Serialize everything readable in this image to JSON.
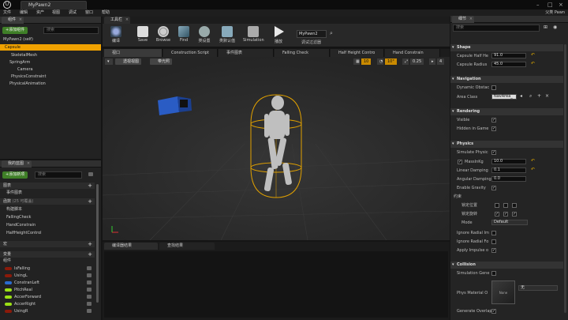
{
  "window": {
    "title": "MyPawn2",
    "user": "父类 Pawn",
    "controls": [
      "–",
      "□",
      "×"
    ]
  },
  "menubar": {
    "items": [
      "文件",
      "编辑",
      "资产",
      "视图",
      "调试",
      "窗口",
      "帮助"
    ]
  },
  "components_panel": {
    "tab": "组件",
    "add_button": "+添加组件",
    "search_placeholder": "搜索",
    "items": [
      {
        "label": "MyPawn2 (self)",
        "level": 0
      },
      {
        "label": "Capsule",
        "level": 0,
        "selected": true
      },
      {
        "label": "SkeletalMesh",
        "level": 1
      },
      {
        "label": "SpringArm",
        "level": 1
      },
      {
        "label": "Camera",
        "level": 2
      },
      {
        "label": "PhysicsConstraint",
        "level": 1
      },
      {
        "label": "PhysicalAnimation",
        "level": 1
      }
    ]
  },
  "mybp_panel": {
    "tab": "我的蓝图",
    "add_button": "+添加新项",
    "search_placeholder": "搜索",
    "sections": {
      "graphs": "图表",
      "event_graph": "事件图表",
      "functions": "函数",
      "functions_count": "(25 可覆盖)",
      "macros": "宏",
      "variables": "变量",
      "components": "组件"
    },
    "functions": [
      "构建脚本",
      "FallingCheck",
      "HandConstrain",
      "HalfHeightControl"
    ],
    "variables": [
      {
        "name": "IsFalling",
        "color": "#8b1a0a"
      },
      {
        "name": "UsingL",
        "color": "#8b1a0a"
      },
      {
        "name": "ConstranLeft",
        "color": "#2a6bd1"
      },
      {
        "name": "PitchReal",
        "color": "#9be015"
      },
      {
        "name": "AccerForward",
        "color": "#9be015"
      },
      {
        "name": "AccerRight",
        "color": "#9be015"
      },
      {
        "name": "UsingR",
        "color": "#8b1a0a"
      }
    ]
  },
  "toolbar": {
    "doc_tab": "工具栏",
    "buttons": [
      {
        "label": "编译",
        "icon": "compile-icon"
      },
      {
        "label": "Save",
        "icon": "save-icon"
      },
      {
        "label": "Browse",
        "icon": "browse-icon"
      },
      {
        "label": "Find",
        "icon": "find-icon"
      },
      {
        "label": "类设置",
        "icon": "class-settings-icon"
      },
      {
        "label": "类默认值",
        "icon": "class-defaults-icon"
      },
      {
        "label": "Simulation",
        "icon": "simulation-icon"
      },
      {
        "label": "播放",
        "icon": "play-icon"
      }
    ],
    "debug_object": "MyPawn2",
    "debug_label": "调试过滤器"
  },
  "editor_tabs": [
    "视口",
    "Construction Script",
    "事件图表",
    "Falling Check",
    "Half Height Contro",
    "Hand Constrain"
  ],
  "viewport": {
    "view_button": "透视视图",
    "lit_button": "带光照",
    "grid": "10",
    "rot": "10°",
    "scale": "0.25",
    "cam": "4"
  },
  "bottom_tabs": [
    "编译器结果",
    "查找结果"
  ],
  "details": {
    "tab": "细节",
    "search_placeholder": "搜索",
    "shape": {
      "title": "Shape",
      "half_height_label": "Capsule Half He",
      "half_height": "91.0",
      "radius_label": "Capsule Radius",
      "radius": "45.0"
    },
    "navigation": {
      "title": "Navigation",
      "dynamic_label": "Dynamic Obstac",
      "area_label": "Area Class",
      "area_value": "NavArea_"
    },
    "rendering": {
      "title": "Rendering",
      "visible_label": "Visible",
      "hidden_label": "Hidden in Game"
    },
    "physics": {
      "title": "Physics",
      "simulate_label": "Simulate Physic",
      "mass_label": "MassInKg",
      "mass": "10.0",
      "linear_label": "Linear Damping",
      "linear": "0.1",
      "angular_label": "Angular Damping",
      "angular": "0.0",
      "gravity_label": "Enable Gravity",
      "constraints": "约束",
      "lock_pos": "锁定位置",
      "lock_rot": "锁定旋转",
      "mode_label": "Mode",
      "mode_value": "Default",
      "ignore1": "Ignore Radial Im",
      "ignore2": "Ignore Radial Fo",
      "apply_impulse": "Apply Impulse o"
    },
    "collision": {
      "title": "Collision",
      "sim_gen_label": "Simulation Gene",
      "phys_mat_label": "Phys Material O",
      "phys_mat_value": "None",
      "phys_select": "无",
      "overlap_label": "Generate Overlap"
    }
  }
}
